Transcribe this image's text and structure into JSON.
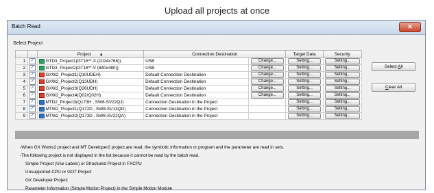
{
  "caption": "Upload all projects at once",
  "dialog": {
    "title": "Batch Read",
    "close_glyph": "✕"
  },
  "select_project_label": "Select Project",
  "table": {
    "headers": {
      "project": "Project",
      "sort": "▲",
      "destination": "Connection Destination",
      "target": "Target Data",
      "security": "Security"
    },
    "change_label": "Change...",
    "setting_label": "Setting...",
    "rows": [
      {
        "num": "1",
        "checked": "✓",
        "icon": "got-icon",
        "project": "GTD3_Project1(GT16**-X (1024x768))",
        "destination": "USB",
        "has_change": true
      },
      {
        "num": "2",
        "checked": "✓",
        "icon": "got-icon",
        "project": "GTD3_Project2(GT16**-V (640x480))",
        "destination": "USB",
        "has_change": true
      },
      {
        "num": "3",
        "checked": "✓",
        "icon": "gx-works2-icon",
        "project": "GXW2_Project1(Q10UDEH)",
        "destination": "Default Connection Destination",
        "has_change": true
      },
      {
        "num": "4",
        "checked": "✓",
        "icon": "gx-works2-icon",
        "project": "GXW2_Project2(Q13UDH)",
        "destination": "Default Connection Destination",
        "has_change": true
      },
      {
        "num": "5",
        "checked": "✓",
        "icon": "gx-works2-icon",
        "project": "GXW2_Project3(Q26UDH)",
        "destination": "Default Connection Destination",
        "has_change": true
      },
      {
        "num": "6",
        "checked": "✓",
        "icon": "gx-works2-icon",
        "project": "GXW2_Project4(Q02/Q02H)",
        "destination": "Default Connection Destination",
        "has_change": true
      },
      {
        "num": "7",
        "checked": "✓",
        "icon": "mt-developer2-icon",
        "project": "MTD2_Project3(Q173H , SW6-SV22QJ)",
        "destination": "Connection Destination in the Project",
        "has_change": false
      },
      {
        "num": "8",
        "checked": "✓",
        "icon": "mt-developer2-icon",
        "project": "MTW2_Project1(Q172D , SW8-SV13QD)",
        "destination": "Connection Destination in the Project",
        "has_change": false
      },
      {
        "num": "9",
        "checked": "✓",
        "icon": "mt-developer2-icon",
        "project": "MTW2_Project2(Q173D , SW8-SV22QA)",
        "destination": "Connection Destination in the Project",
        "has_change": false
      }
    ]
  },
  "buttons": {
    "select_all_prefix": "Select ",
    "select_all_key": "A",
    "select_all_suffix": "ll",
    "clear_all_key": "C",
    "clear_all_suffix": "lear All"
  },
  "notes": {
    "line1": "-When GX Works2 project and MT Developer2 project are read, the symbolic information or program and the parameter are read in sets.",
    "line2": "-The following project is not displayed in the list because it cannot be read by the batch read.",
    "item1": "Simple Project (Use Labels) or Structured Project in FXCPU",
    "item2": "Unsupported CPU or GOT Project",
    "item3": "GX Developer Project",
    "item4": "Parameter Information (Simple Motion Project) in the Simple Motion Module"
  },
  "colors": {
    "got_icon": "#2aa05a",
    "gx_icon": "#d9412b",
    "mt_icon": "#2f6fc7",
    "close_button": "#c7452b"
  }
}
